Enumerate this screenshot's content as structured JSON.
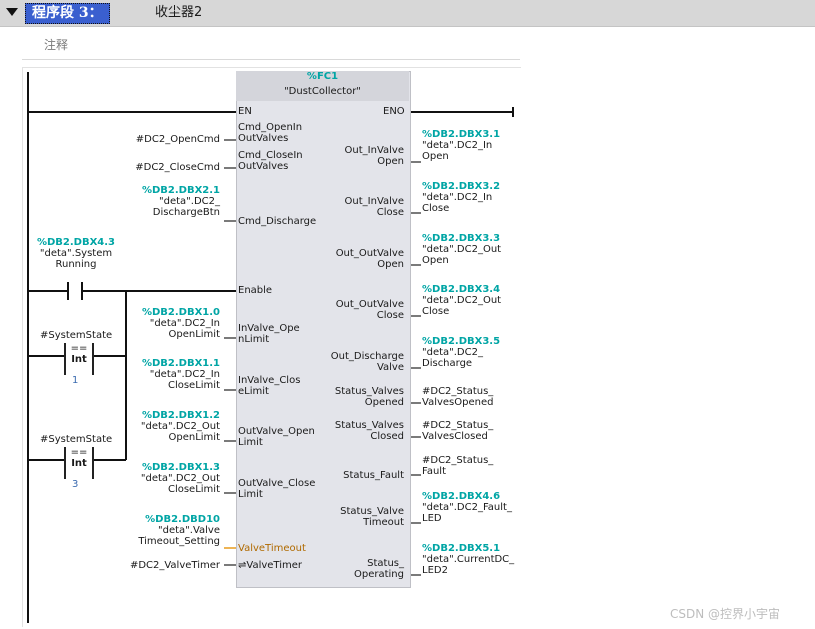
{
  "network": {
    "title": "程序段 3：",
    "name": "收尘器2",
    "comment": "注释"
  },
  "block": {
    "address": "%FC1",
    "name": "\"DustCollector\"",
    "en": "EN",
    "eno": "ENO"
  },
  "contact": {
    "address": "%DB2.DBX4.3",
    "line1": "\"deta\".System",
    "line2": "Running"
  },
  "compare1": {
    "operand": "#SystemState",
    "op": "==",
    "type": "Int",
    "value": "1"
  },
  "compare2": {
    "operand": "#SystemState",
    "op": "==",
    "type": "Int",
    "value": "3"
  },
  "inputs": [
    {
      "pin1": "Cmd_OpenIn",
      "pin2": "OutValves",
      "addr": "",
      "v1": "#DC2_OpenCmd",
      "v2": ""
    },
    {
      "pin1": "Cmd_CloseIn",
      "pin2": "OutValves",
      "addr": "",
      "v1": "#DC2_CloseCmd",
      "v2": ""
    },
    {
      "pin1": "Cmd_Discharge",
      "pin2": "",
      "addr": "%DB2.DBX2.1",
      "v1": "\"deta\".DC2_",
      "v2": "DischargeBtn"
    },
    {
      "pin1": "Enable",
      "pin2": "",
      "addr": "",
      "v1": "",
      "v2": ""
    },
    {
      "pin1": "InValve_Ope",
      "pin2": "nLimit",
      "addr": "%DB2.DBX1.0",
      "v1": "\"deta\".DC2_In",
      "v2": "OpenLimit"
    },
    {
      "pin1": "InValve_Clos",
      "pin2": "eLimit",
      "addr": "%DB2.DBX1.1",
      "v1": "\"deta\".DC2_In",
      "v2": "CloseLimit"
    },
    {
      "pin1": "OutValve_Open",
      "pin2": "Limit",
      "addr": "%DB2.DBX1.2",
      "v1": "\"deta\".DC2_Out",
      "v2": "OpenLimit"
    },
    {
      "pin1": "OutValve_Close",
      "pin2": "Limit",
      "addr": "%DB2.DBX1.3",
      "v1": "\"deta\".DC2_Out",
      "v2": "CloseLimit"
    },
    {
      "pin1": "ValveTimeout",
      "pin2": "",
      "addr": "%DB2.DBD10",
      "v1": "\"deta\".Valve",
      "v2": "Timeout_Setting"
    },
    {
      "pin1": "⇌ValveTimer",
      "pin2": "",
      "addr": "",
      "v1": "#DC2_ValveTimer",
      "v2": ""
    }
  ],
  "outputs": [
    {
      "pin1": "Out_InValve",
      "pin2": "Open",
      "addr": "%DB2.DBX3.1",
      "v1": "\"deta\".DC2_In",
      "v2": "Open"
    },
    {
      "pin1": "Out_InValve",
      "pin2": "Close",
      "addr": "%DB2.DBX3.2",
      "v1": "\"deta\".DC2_In",
      "v2": "Close"
    },
    {
      "pin1": "Out_OutValve",
      "pin2": "Open",
      "addr": "%DB2.DBX3.3",
      "v1": "\"deta\".DC2_Out",
      "v2": "Open"
    },
    {
      "pin1": "Out_OutValve",
      "pin2": "Close",
      "addr": "%DB2.DBX3.4",
      "v1": "\"deta\".DC2_Out",
      "v2": "Close"
    },
    {
      "pin1": "Out_Discharge",
      "pin2": "Valve",
      "addr": "%DB2.DBX3.5",
      "v1": "\"deta\".DC2_",
      "v2": "Discharge"
    },
    {
      "pin1": "Status_Valves",
      "pin2": "Opened",
      "addr": "",
      "v1": "#DC2_Status_",
      "v2": "ValvesOpened"
    },
    {
      "pin1": "Status_Valves",
      "pin2": "Closed",
      "addr": "",
      "v1": "#DC2_Status_",
      "v2": "ValvesClosed"
    },
    {
      "pin1": "Status_Fault",
      "pin2": "",
      "addr": "",
      "v1": "#DC2_Status_",
      "v2": "Fault"
    },
    {
      "pin1": "Status_Valve",
      "pin2": "Timeout",
      "addr": "%DB2.DBX4.6",
      "v1": "\"deta\".DC2_Fault_",
      "v2": "LED"
    },
    {
      "pin1": "Status_",
      "pin2": "Operating",
      "addr": "%DB2.DBX5.1",
      "v1": "\"deta\".CurrentDC_",
      "v2": "LED2"
    }
  ],
  "watermark": "CSDN @控界小宇宙",
  "colors": {
    "address": "#00a5a5",
    "header_bg": "#d7d7d7",
    "title_bg": "#3a5fcf",
    "block_bg": "#e3e4ea",
    "wire_orange": "#e89a1a"
  }
}
